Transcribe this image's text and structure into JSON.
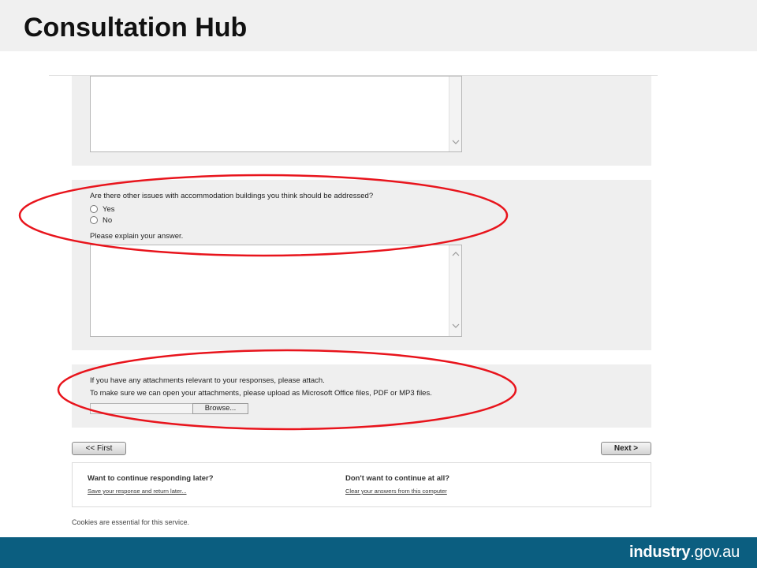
{
  "slide": {
    "title": "Consultation Hub"
  },
  "question_accommodation": {
    "prompt": "Are there other issues with accommodation buildings you think should be addressed?",
    "options": [
      "Yes",
      "No"
    ],
    "explain_label": "Please explain your answer."
  },
  "attachments": {
    "heading": "If you have any attachments relevant to your responses, please attach.",
    "instructions": "To make sure we can open your attachments, please upload as Microsoft Office files, PDF or MP3 files.",
    "browse_label": "Browse..."
  },
  "navigation": {
    "first_label": "<< First",
    "next_label": "Next >"
  },
  "continue_panel": {
    "later_heading": "Want to continue responding later?",
    "later_link": "Save your response and return later...",
    "stop_heading": "Don't want to continue at all?",
    "stop_link": "Clear your answers from this computer"
  },
  "cookies_notice": "Cookies are essential for this service.",
  "footer": {
    "brand_bold": "industry",
    "brand_rest": ".gov.au",
    "background_color": "#0b5e80"
  },
  "annotation_color": "#e8141c"
}
